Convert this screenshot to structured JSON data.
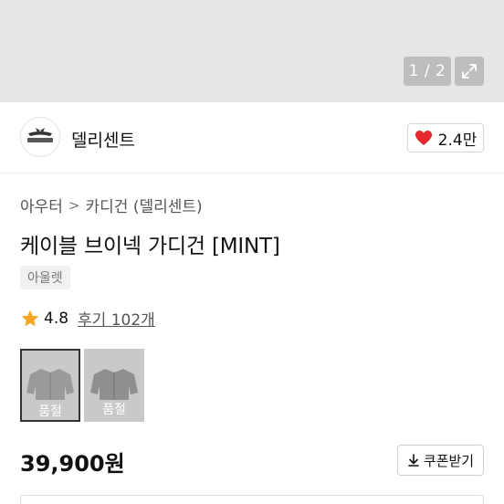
{
  "gallery": {
    "pager": "1 / 2"
  },
  "brand": {
    "name": "델리센트",
    "likes": "2.4만"
  },
  "breadcrumb": {
    "category": "아우터",
    "sep": ">",
    "subcategory": "카디건 (델리센트)"
  },
  "product": {
    "title": "케이블 브이넥 가디건 [MINT]",
    "tag": "아울렛",
    "rating": "4.8",
    "reviews": "후기 102개",
    "price": "39,900원",
    "coupon_label": "쿠폰받기"
  },
  "thumbnails": [
    {
      "label": "품절",
      "selected": true
    },
    {
      "label": "품절",
      "selected": false
    }
  ],
  "colors": {
    "heart": "#e5282c",
    "star": "#f5a623",
    "hero_bg": "#e6e6e6"
  }
}
